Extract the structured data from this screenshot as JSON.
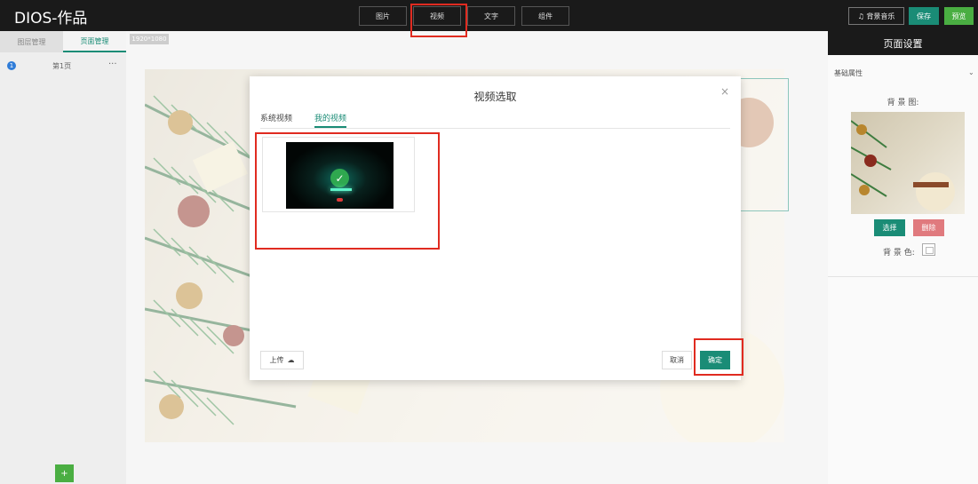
{
  "app": {
    "title": "DIOS-作品"
  },
  "toolbar": {
    "tabs": [
      {
        "label": "图片"
      },
      {
        "label": "视频"
      },
      {
        "label": "文字"
      },
      {
        "label": "组件"
      }
    ],
    "music_label": "♫ 背景音乐",
    "save_label": "保存",
    "preview_label": "预览"
  },
  "left_panel": {
    "tabs": [
      {
        "label": "图层管理"
      },
      {
        "label": "页面管理"
      }
    ],
    "pages": [
      {
        "number": "1",
        "label": "第1页",
        "more": "···"
      }
    ],
    "add_label": "+"
  },
  "canvas": {
    "size_label": "1920*1080"
  },
  "right_panel": {
    "title": "页面设置",
    "section_title": "基础属性",
    "caret": "⌄",
    "bg_image_label": "背 景 图:",
    "select_label": "选择",
    "delete_label": "删除",
    "bg_color_label": "背 景 色:"
  },
  "modal": {
    "title": "视频选取",
    "close": "×",
    "tabs": [
      {
        "label": "系统视频"
      },
      {
        "label": "我的视频"
      }
    ],
    "upload_label": "上传",
    "upload_icon": "☁",
    "cancel_label": "取消",
    "confirm_label": "确定",
    "check_icon": "✓"
  },
  "colors": {
    "accent": "#1a8c76",
    "green": "#4aae42",
    "danger": "#e07a7e",
    "highlight": "#e02b20",
    "topbar": "#1a1a1a"
  }
}
